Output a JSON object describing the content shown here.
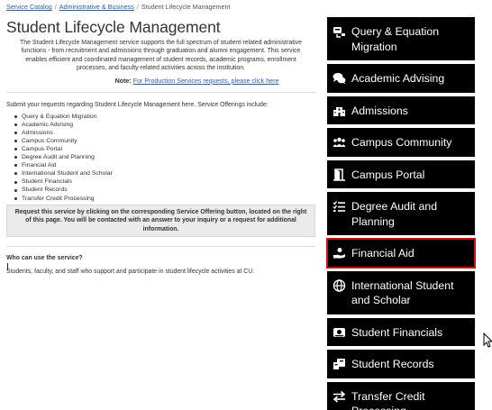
{
  "breadcrumb": {
    "item1": "Service Catalog",
    "item2": "Administrative & Business",
    "item3": "Student Lifecycle Management",
    "separator": "/"
  },
  "main": {
    "title": "Student Lifecycle Management",
    "intro": "The Student Lifecycle Management service supports the full spectrum of student-related administrative functions - from recruitment and admissions through graduation and alumni engagement. This service enables efficient and coordinated management of student records, academic programs, enrollment processes, and faculty-related activities across the institution.",
    "note_label": "Note:",
    "note_link": "For Production Services requests, please click here",
    "submit_text": "Submit your requests regarding Student Lifecycle Management here. Service Offerings include:",
    "offerings": [
      "Query & Equation Migration",
      "Academic Advising",
      "Admissions",
      "Campus Community",
      "Campus Portal",
      "Degree Audit and Planning",
      "Financial Aid",
      "International Student and Scholar",
      "Student Financials",
      "Student Records",
      "Transfer Credit Processing"
    ],
    "request_box": "Request this service by clicking on the corresponding Service Offering button, located on the right of this page. You will be contacted with an answer to your inquiry or a request for additional information.",
    "who_heading": "Who can use the service?",
    "who_text": "Students, faculty, and staff who support and participate in student lifecycle activities at CU."
  },
  "sidebar": {
    "buttons": [
      {
        "label": "Query & Equation Migration",
        "icon": "database-arrows-icon"
      },
      {
        "label": "Academic Advising",
        "icon": "chat-bubbles-icon"
      },
      {
        "label": "Admissions",
        "icon": "building-icon"
      },
      {
        "label": "Campus Community",
        "icon": "users-icon"
      },
      {
        "label": "Campus Portal",
        "icon": "door-icon"
      },
      {
        "label": "Degree Audit and Planning",
        "icon": "checklist-icon"
      },
      {
        "label": "Financial Aid",
        "icon": "hand-money-icon",
        "active": true
      },
      {
        "label": "International Student and Scholar",
        "icon": "globe-icon"
      },
      {
        "label": "Student Financials",
        "icon": "money-bill-icon"
      },
      {
        "label": "Student Records",
        "icon": "id-card-icon"
      },
      {
        "label": "Transfer Credit Processing",
        "icon": "exchange-icon"
      }
    ]
  },
  "colors": {
    "link": "#2a5db0",
    "button_bg": "#000000",
    "button_text": "#ffffff",
    "active_outline": "#d01010",
    "request_box_bg": "#ebebeb"
  }
}
